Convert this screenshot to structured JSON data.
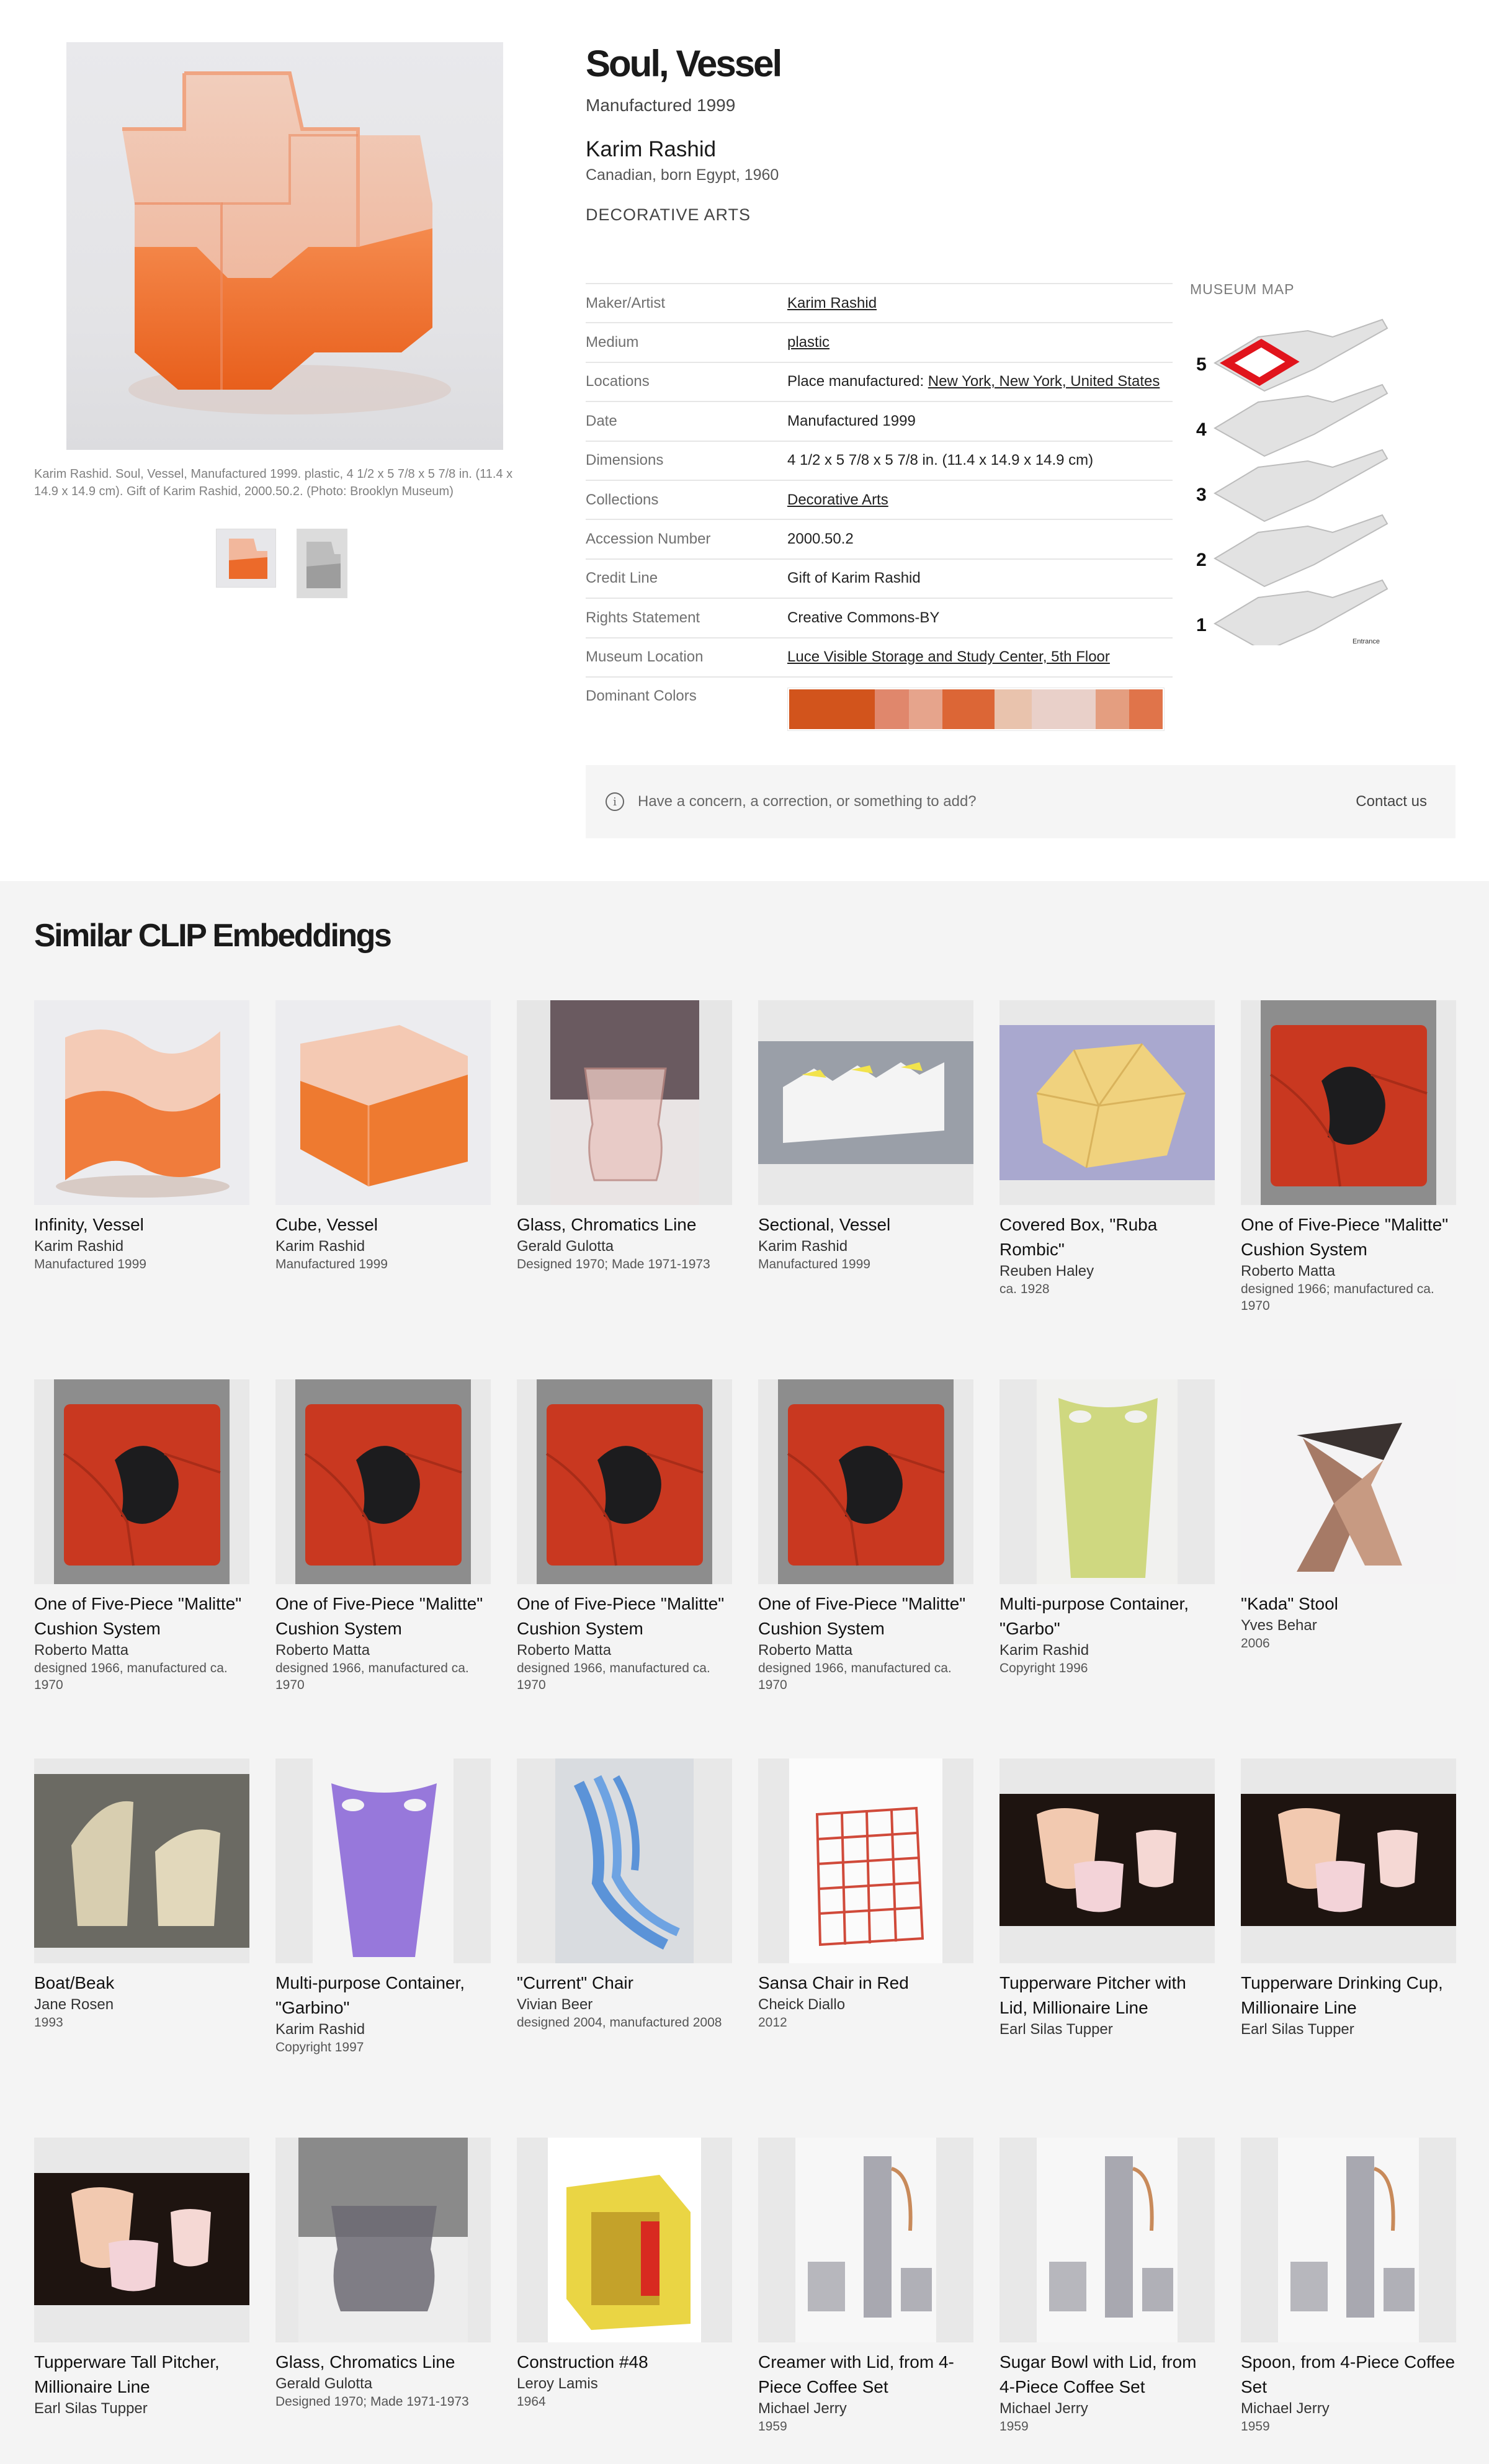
{
  "object": {
    "title": "Soul, Vessel",
    "date_line": "Manufactured 1999",
    "artist": "Karim Rashid",
    "artist_bio": "Canadian, born Egypt, 1960",
    "department": "DECORATIVE ARTS",
    "caption": "Karim Rashid. Soul, Vessel, Manufactured 1999. plastic, 4 1/2 x 5 7/8 x 5 7/8 in. (11.4 x 14.9 x 14.9 cm). Gift of Karim Rashid, 2000.50.2. (Photo: Brooklyn Museum)"
  },
  "details": {
    "maker_label": "Maker/Artist",
    "maker_value": "Karim Rashid",
    "medium_label": "Medium",
    "medium_value": "plastic",
    "locations_label": "Locations",
    "locations_prefix": "Place manufactured: ",
    "locations_value": "New York, New York, United States",
    "date_label": "Date",
    "date_value": "Manufactured 1999",
    "dimensions_label": "Dimensions",
    "dimensions_value": "4 1/2 x 5 7/8 x 5 7/8 in. (11.4 x 14.9 x 14.9 cm)",
    "collections_label": "Collections",
    "collections_value": "Decorative Arts",
    "accession_label": "Accession Number",
    "accession_value": "2000.50.2",
    "credit_label": "Credit Line",
    "credit_value": "Gift of Karim Rashid",
    "rights_label": "Rights Statement",
    "rights_value": "Creative Commons-BY",
    "museum_location_label": "Museum Location",
    "museum_location_value": "Luce Visible Storage and Study Center, 5th Floor",
    "colors_label": "Dominant Colors"
  },
  "dominant_colors": [
    {
      "hex": "#d2541c",
      "weight": 0.23
    },
    {
      "hex": "#e0876c",
      "weight": 0.09
    },
    {
      "hex": "#e6a48c",
      "weight": 0.09
    },
    {
      "hex": "#dc6636",
      "weight": 0.14
    },
    {
      "hex": "#e9c3ad",
      "weight": 0.1
    },
    {
      "hex": "#e9d0c9",
      "weight": 0.17
    },
    {
      "hex": "#e49e80",
      "weight": 0.09
    },
    {
      "hex": "#e0744a",
      "weight": 0.09
    }
  ],
  "museum_map": {
    "title": "MUSEUM MAP",
    "floors": [
      "5",
      "4",
      "3",
      "2",
      "1"
    ],
    "entrance_label": "Entrance",
    "highlight_floor": "5",
    "highlight_color": "#e1141c"
  },
  "feedback": {
    "message": "Have a concern, a correction, or something to add?",
    "contact_label": "Contact us"
  },
  "similar": {
    "heading": "Similar CLIP Embeddings",
    "items": [
      {
        "title": "Infinity, Vessel",
        "artist": "Karim Rashid",
        "date": "Manufactured 1999",
        "art": "vessel-wave"
      },
      {
        "title": "Cube, Vessel",
        "artist": "Karim Rashid",
        "date": "Manufactured 1999",
        "art": "vessel-cube"
      },
      {
        "title": "Glass, Chromatics Line",
        "artist": "Gerald Gulotta",
        "date": "Designed 1970; Made 1971-1973",
        "art": "glass-pink"
      },
      {
        "title": "Sectional, Vessel",
        "artist": "Karim Rashid",
        "date": "Manufactured 1999",
        "art": "sectional"
      },
      {
        "title": "Covered Box, \"Ruba Rombic\"",
        "artist": "Reuben Haley",
        "date": "ca. 1928",
        "art": "ruba"
      },
      {
        "title": "One of Five-Piece \"Malitte\" Cushion System",
        "artist": "Roberto Matta",
        "date": "designed 1966; manufactured ca. 1970",
        "art": "malitte"
      },
      {
        "title": "One of Five-Piece \"Malitte\" Cushion System",
        "artist": "Roberto Matta",
        "date": "designed 1966, manufactured ca. 1970",
        "art": "malitte"
      },
      {
        "title": "One of Five-Piece \"Malitte\" Cushion System",
        "artist": "Roberto Matta",
        "date": "designed 1966, manufactured ca. 1970",
        "art": "malitte"
      },
      {
        "title": "One of Five-Piece \"Malitte\" Cushion System",
        "artist": "Roberto Matta",
        "date": "designed 1966, manufactured ca. 1970",
        "art": "malitte"
      },
      {
        "title": "One of Five-Piece \"Malitte\" Cushion System",
        "artist": "Roberto Matta",
        "date": "designed 1966, manufactured ca. 1970",
        "art": "malitte"
      },
      {
        "title": "Multi-purpose Container, \"Garbo\"",
        "artist": "Karim Rashid",
        "date": "Copyright 1996",
        "art": "garbo-green"
      },
      {
        "title": "\"Kada\" Stool",
        "artist": "Yves Behar",
        "date": "2006",
        "art": "kada"
      },
      {
        "title": "Boat/Beak",
        "artist": "Jane Rosen",
        "date": "1993",
        "art": "boat"
      },
      {
        "title": "Multi-purpose Container, \"Garbino\"",
        "artist": "Karim Rashid",
        "date": "Copyright 1997",
        "art": "garbo-purple"
      },
      {
        "title": "\"Current\" Chair",
        "artist": "Vivian Beer",
        "date": "designed 2004, manufactured 2008",
        "art": "current"
      },
      {
        "title": "Sansa Chair in Red",
        "artist": "Cheick Diallo",
        "date": "2012",
        "art": "sansa"
      },
      {
        "title": "Tupperware Pitcher with Lid, Millionaire Line",
        "artist": "Earl Silas Tupper",
        "date": "",
        "art": "tupper"
      },
      {
        "title": "Tupperware Drinking Cup, Millionaire Line",
        "artist": "Earl Silas Tupper",
        "date": "",
        "art": "tupper"
      },
      {
        "title": "Tupperware Tall Pitcher, Millionaire Line",
        "artist": "Earl Silas Tupper",
        "date": "",
        "art": "tupper"
      },
      {
        "title": "Glass, Chromatics Line",
        "artist": "Gerald Gulotta",
        "date": "Designed 1970; Made 1971-1973",
        "art": "glass-grey"
      },
      {
        "title": "Construction #48",
        "artist": "Leroy Lamis",
        "date": "1964",
        "art": "construction"
      },
      {
        "title": "Creamer with Lid, from 4-Piece Coffee Set",
        "artist": "Michael Jerry",
        "date": "1959",
        "art": "coffee"
      },
      {
        "title": "Sugar Bowl with Lid, from 4-Piece Coffee Set",
        "artist": "Michael Jerry",
        "date": "1959",
        "art": "coffee"
      },
      {
        "title": "Spoon, from 4-Piece Coffee Set",
        "artist": "Michael Jerry",
        "date": "1959",
        "art": "coffee"
      }
    ]
  }
}
